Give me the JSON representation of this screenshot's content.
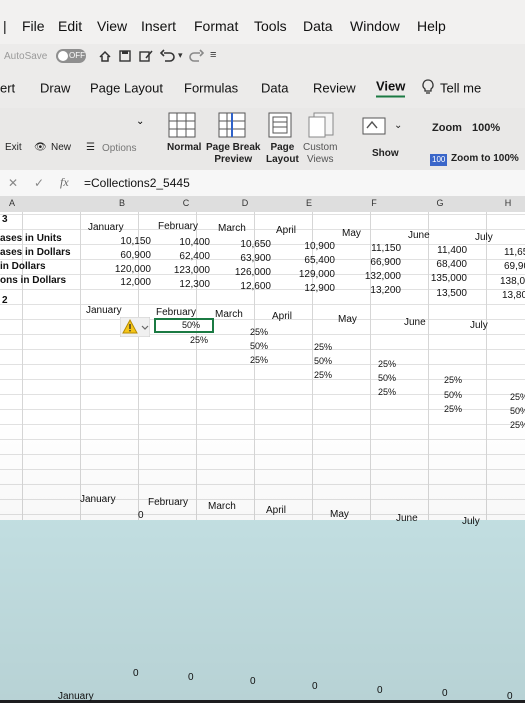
{
  "menu": {
    "items": [
      "File",
      "Edit",
      "View",
      "Insert",
      "Format",
      "Tools",
      "Data",
      "Window",
      "Help"
    ]
  },
  "quick_access": {
    "autosave_label": "AutoSave",
    "autosave_state": "OFF"
  },
  "ribbon_tabs": [
    "ert",
    "Draw",
    "Page Layout",
    "Formulas",
    "Data",
    "Review",
    "View"
  ],
  "active_tab": "View",
  "tell_me": "Tell me",
  "ribbon": {
    "exit": "Exit",
    "new": "New",
    "options": "Options",
    "normal": "Normal",
    "page_break_1": "Page Break",
    "page_break_2": "Preview",
    "page_layout_1": "Page",
    "page_layout_2": "Layout",
    "custom_1": "Custom",
    "custom_2": "Views",
    "show": "Show",
    "zoom_label": "Zoom",
    "zoom_value": "100%",
    "zoom_badge": "100",
    "zoom_100": "Zoom to 100%"
  },
  "formula_bar": {
    "fx": "fx",
    "content": "=Collections2_5445"
  },
  "columns": [
    "A",
    "B",
    "C",
    "D",
    "E",
    "F",
    "G",
    "H"
  ],
  "table1": {
    "row_marker": "3",
    "months": [
      "January",
      "February",
      "March",
      "April",
      "May",
      "June",
      "July"
    ],
    "labels": [
      "ases in Units",
      "ases in Dollars",
      "in Dollars",
      "ons in Dollars"
    ],
    "units": [
      "10,150",
      "10,400",
      "10,650",
      "10,900",
      "11,150",
      "11,400",
      "11,65"
    ],
    "sales_dollars": [
      "60,900",
      "62,400",
      "63,900",
      "65,400",
      "66,900",
      "68,400",
      "69,90"
    ],
    "dollars": [
      "120,000",
      "123,000",
      "126,000",
      "129,000",
      "132,000",
      "135,000",
      "138,00"
    ],
    "coll_dollars": [
      "12,000",
      "12,300",
      "12,600",
      "12,900",
      "13,200",
      "13,500",
      "13,80"
    ]
  },
  "table2": {
    "row_marker": "2",
    "months": [
      "January",
      "February",
      "March",
      "April",
      "May",
      "June",
      "July"
    ],
    "selected_value": "50%",
    "selected_below": "25%",
    "pct_25": "25%",
    "pct_50": "50%"
  },
  "table3": {
    "months": [
      "January",
      "February",
      "March",
      "April",
      "May",
      "June",
      "July"
    ],
    "zero": "0",
    "bottom_zeros": [
      "0",
      "0",
      "0",
      "0",
      "0",
      "0",
      "0"
    ],
    "bottom_label": "January"
  },
  "colors": {
    "selection": "#1b7a43",
    "chart_fill": "#c7e4e7",
    "warning": "#f5c518"
  }
}
